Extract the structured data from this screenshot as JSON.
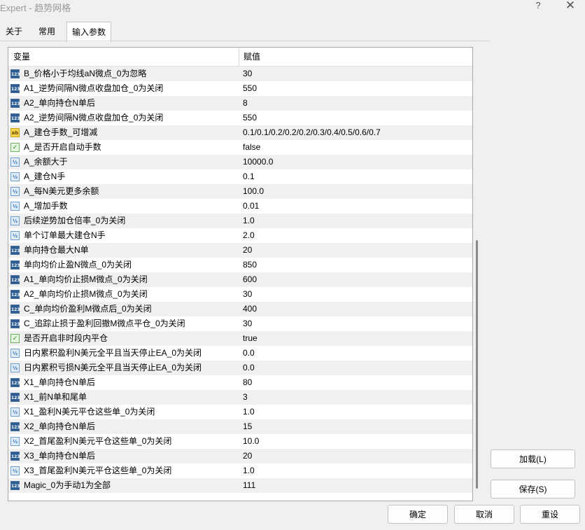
{
  "window": {
    "title": "Expert - 趋势网格",
    "help_label": "?",
    "close_label": "✕"
  },
  "tabs": [
    {
      "label": "关于"
    },
    {
      "label": "常用"
    },
    {
      "label": "输入参数",
      "selected": true
    }
  ],
  "table": {
    "headers": {
      "name": "变量",
      "value": "赋值"
    },
    "rows": [
      {
        "type": "int",
        "name": "B_价格小于均线aN微点_0为忽略",
        "value": "30"
      },
      {
        "type": "int",
        "name": "A1_逆势间隔N微点收盘加仓_0为关闭",
        "value": "550"
      },
      {
        "type": "int",
        "name": "A2_单向持仓N单后",
        "value": "8"
      },
      {
        "type": "int",
        "name": "A2_逆势间隔N微点收盘加仓_0为关闭",
        "value": "550"
      },
      {
        "type": "string",
        "name": "A_建仓手数_可增减",
        "value": "0.1/0.1/0.2/0.2/0.2/0.3/0.4/0.5/0.6/0.7"
      },
      {
        "type": "bool",
        "name": "A_是否开启自动手数",
        "value": "false"
      },
      {
        "type": "double",
        "name": "A_余额大于",
        "value": "10000.0"
      },
      {
        "type": "double",
        "name": "A_建仓N手",
        "value": "0.1"
      },
      {
        "type": "double",
        "name": "A_每N美元更多余额",
        "value": "100.0"
      },
      {
        "type": "double",
        "name": "A_增加手数",
        "value": "0.01"
      },
      {
        "type": "double",
        "name": "后续逆势加仓倍率_0为关闭",
        "value": "1.0"
      },
      {
        "type": "double",
        "name": "单个订单最大建仓N手",
        "value": "2.0"
      },
      {
        "type": "int",
        "name": "单向持仓最大N单",
        "value": "20"
      },
      {
        "type": "int",
        "name": "单向均价止盈N微点_0为关闭",
        "value": "850"
      },
      {
        "type": "int",
        "name": "A1_单向均价止损M微点_0为关闭",
        "value": "600"
      },
      {
        "type": "int",
        "name": "A2_单向均价止损M微点_0为关闭",
        "value": "30"
      },
      {
        "type": "int",
        "name": "C_单向均价盈利M微点后_0为关闭",
        "value": "400"
      },
      {
        "type": "int",
        "name": "C_追踪止损于盈利回撤M微点平仓_0为关闭",
        "value": "30"
      },
      {
        "type": "bool",
        "name": "是否开启非时段内平仓",
        "value": "true"
      },
      {
        "type": "double",
        "name": "日内累积盈利N美元全平且当天停止EA_0为关闭",
        "value": "0.0"
      },
      {
        "type": "double",
        "name": "日内累积亏损N美元全平且当天停止EA_0为关闭",
        "value": "0.0"
      },
      {
        "type": "int",
        "name": "X1_单向持仓N单后",
        "value": "80"
      },
      {
        "type": "int",
        "name": "X1_前N单和尾单",
        "value": "3"
      },
      {
        "type": "double",
        "name": "X1_盈利N美元平仓这些单_0为关闭",
        "value": "1.0"
      },
      {
        "type": "int",
        "name": "X2_单向持仓N单后",
        "value": "15"
      },
      {
        "type": "double",
        "name": "X2_首尾盈利N美元平仓这些单_0为关闭",
        "value": "10.0"
      },
      {
        "type": "int",
        "name": "X3_单向持仓N单后",
        "value": "20"
      },
      {
        "type": "double",
        "name": "X3_首尾盈利N美元平仓这些单_0为关闭",
        "value": "1.0"
      },
      {
        "type": "int",
        "name": "Magic_0为手动1为全部",
        "value": "111"
      }
    ]
  },
  "icons": {
    "int": "123",
    "double": "½",
    "string": "ab",
    "bool": "✓"
  },
  "buttons": {
    "load": "加载(L)",
    "save": "保存(S)",
    "ok": "确定",
    "cancel": "取消",
    "reset": "重设"
  }
}
